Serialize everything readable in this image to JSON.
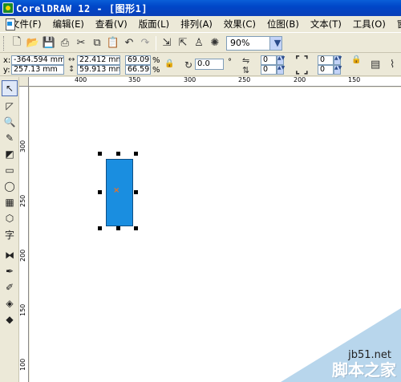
{
  "window": {
    "title": "CorelDRAW 12 - [图形1]"
  },
  "menu": {
    "items": [
      "文件(F)",
      "编辑(E)",
      "查看(V)",
      "版面(L)",
      "排列(A)",
      "效果(C)",
      "位图(B)",
      "文本(T)",
      "工具(O)",
      "窗口"
    ]
  },
  "toolbar": {
    "zoom_value": "90%"
  },
  "propbar": {
    "x_label": "x:",
    "x_value": "-364.594 mm",
    "y_label": "y:",
    "y_value": "257.13 mm",
    "width_value": "22.412 mm",
    "height_value": "59.913 mm",
    "scale_x": "69.09",
    "scale_y": "66.59",
    "percent": "%",
    "rotation": "0.0",
    "degree": "°",
    "corner_a": "0",
    "corner_b": "0",
    "corner_c": "0",
    "corner_d": "0"
  },
  "hruler": {
    "labels": [
      "400",
      "350",
      "300",
      "250",
      "200",
      "150"
    ]
  },
  "vruler": {
    "labels": [
      "300",
      "250",
      "200",
      "150",
      "100"
    ]
  },
  "watermark": {
    "site": "jb51.net",
    "name": "脚本之家"
  },
  "colors": {
    "selected_fill": "#1a8ee0",
    "titlebar": "#0046c8",
    "center_mark": "#f07020"
  }
}
